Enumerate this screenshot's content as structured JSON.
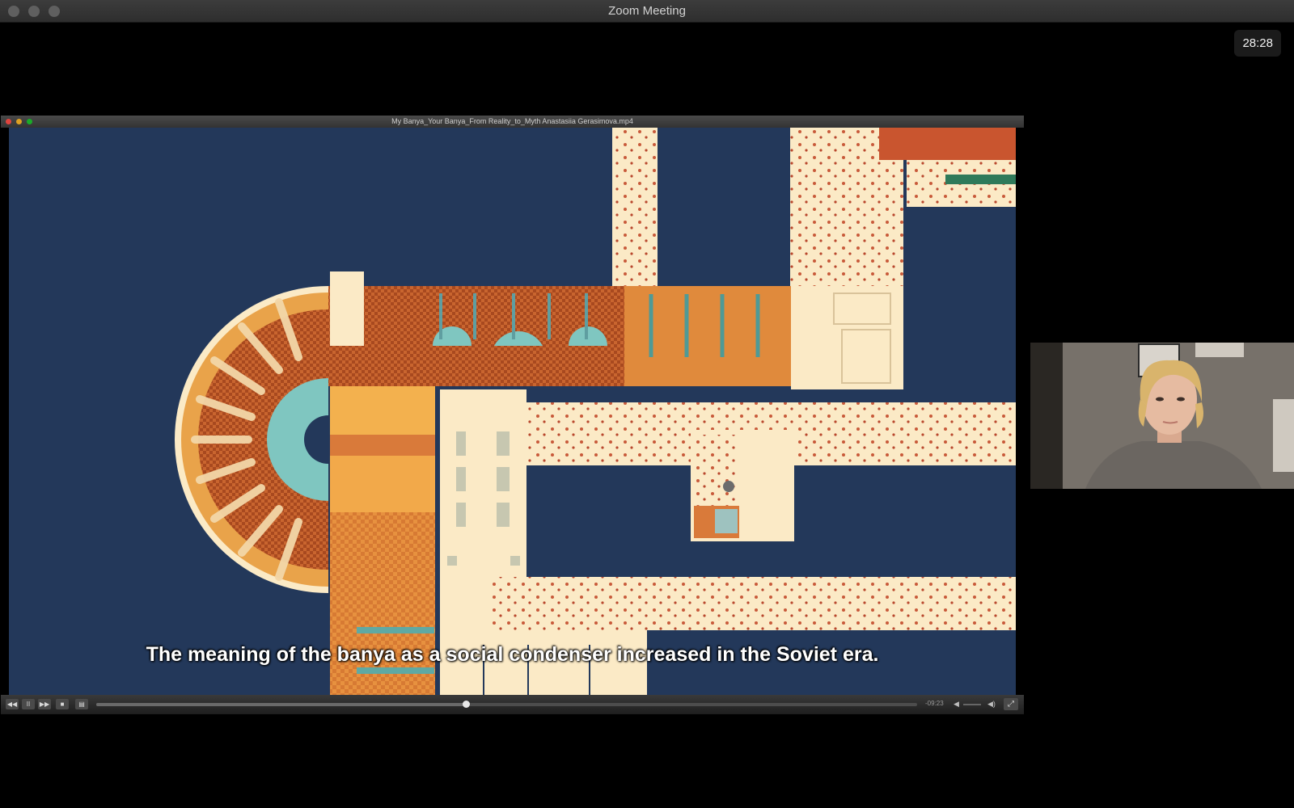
{
  "window": {
    "title": "Zoom Meeting"
  },
  "meeting": {
    "elapsed": "28:28"
  },
  "shared_player": {
    "file_name": "My Banya_Your Banya_From Reality_to_Myth Anastasiia Gerasimova.mp4",
    "subtitle": "The meaning of the banya as a social condenser increased in the Soviet era.",
    "remaining_time": "-09:23",
    "playback_progress": 0.45,
    "buttons": {
      "rewind": "◀◀",
      "pause": "II",
      "forward": "▶▶",
      "stop": "■",
      "captions": "▤",
      "fullscreen": "⤢"
    },
    "icons": {
      "volume_low": "◀",
      "volume_high": "◀)"
    }
  },
  "participant": {
    "video": "participant-camera-feed"
  },
  "colors": {
    "video_background": "#23385a",
    "orange": "#d97a3a",
    "dark_orange": "#b95a2b",
    "cream": "#fbeac6",
    "teal": "#7fc6c0"
  }
}
